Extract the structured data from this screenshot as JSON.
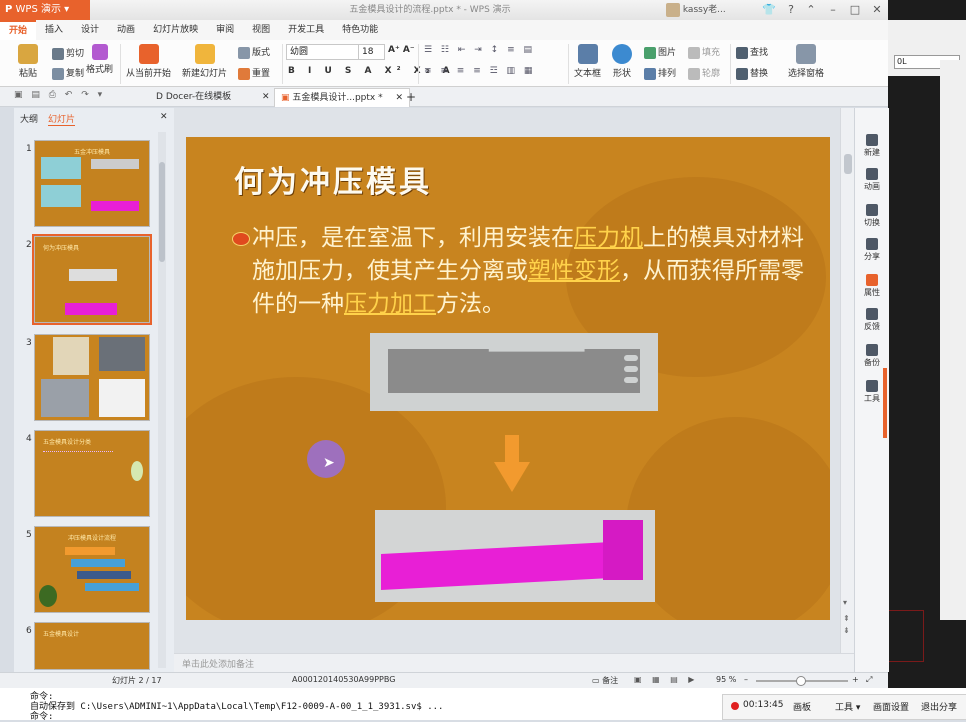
{
  "titlebar": {
    "app_name": "WPS 演示",
    "doc_title": "五金模具设计的流程.pptx * - WPS 演示",
    "user": "kassy老..."
  },
  "ribbon_tabs": [
    "开始",
    "插入",
    "设计",
    "动画",
    "幻灯片放映",
    "审阅",
    "视图",
    "开发工具",
    "特色功能"
  ],
  "ribbon": {
    "paste": "粘贴",
    "cut": "剪切",
    "copy": "复制",
    "format_painter": "格式刷",
    "from_current": "从当前开始",
    "new_slide": "新建幻灯片",
    "layout": "版式",
    "reset": "重置",
    "section": "节",
    "font_name": "幼圆",
    "font_size": "18",
    "textbox": "文本框",
    "shape": "形状",
    "picture": "图片",
    "fill": "填充",
    "arrange": "排列",
    "outline": "轮廓",
    "find": "查找",
    "replace": "替换",
    "select_pane": "选择窗格"
  },
  "doc_tabs": [
    "Docer-在线模板",
    "五金模具设计...pptx *"
  ],
  "left_pane": {
    "tab_outline": "大纲",
    "tab_slides": "幻灯片",
    "thumbs": [
      {
        "num": "1",
        "title": "五金冲压模具"
      },
      {
        "num": "2",
        "title": "何为冲压模具"
      },
      {
        "num": "3",
        "title": ""
      },
      {
        "num": "4",
        "title": "五金模具设计分类"
      },
      {
        "num": "5",
        "title": "冲压模具设计流程"
      },
      {
        "num": "6",
        "title": "五金模具设计"
      }
    ]
  },
  "slide": {
    "title": "何为冲压模具",
    "body_1": "冲压，是在室温下，利用安装在",
    "link_1": "压力机",
    "body_2": "上的模具对材料施加压力，使其产生分离或",
    "link_2": "塑性变形",
    "body_3": "，从而获得所需零件的一种",
    "link_3": "压力加工",
    "body_4": "方法。"
  },
  "notes_placeholder": "单击此处添加备注",
  "right_panel": [
    "新建",
    "动画",
    "切换",
    "分享",
    "属性",
    "反馈",
    "备份",
    "工具"
  ],
  "status": {
    "slide_pos": "幻灯片 2 / 17",
    "template": "A000120140530A99PPBG",
    "notes": "备注",
    "zoom": "95 %"
  },
  "command": {
    "line1": "命令:",
    "line2": "自动保存到 C:\\Users\\ADMINI~1\\AppData\\Local\\Temp\\F12-0009-A-00_1_1_3931.sv$ ...",
    "line3": "命令:"
  },
  "recorder": {
    "time": "00:13:45",
    "draw": "画板",
    "tools": "工具",
    "settings": "画面设置",
    "exit": "退出分享"
  },
  "cad_field": "0L",
  "colors": {
    "accent": "#e8622c",
    "slide_bg": "#c8841f",
    "link": "#ffd24a"
  }
}
